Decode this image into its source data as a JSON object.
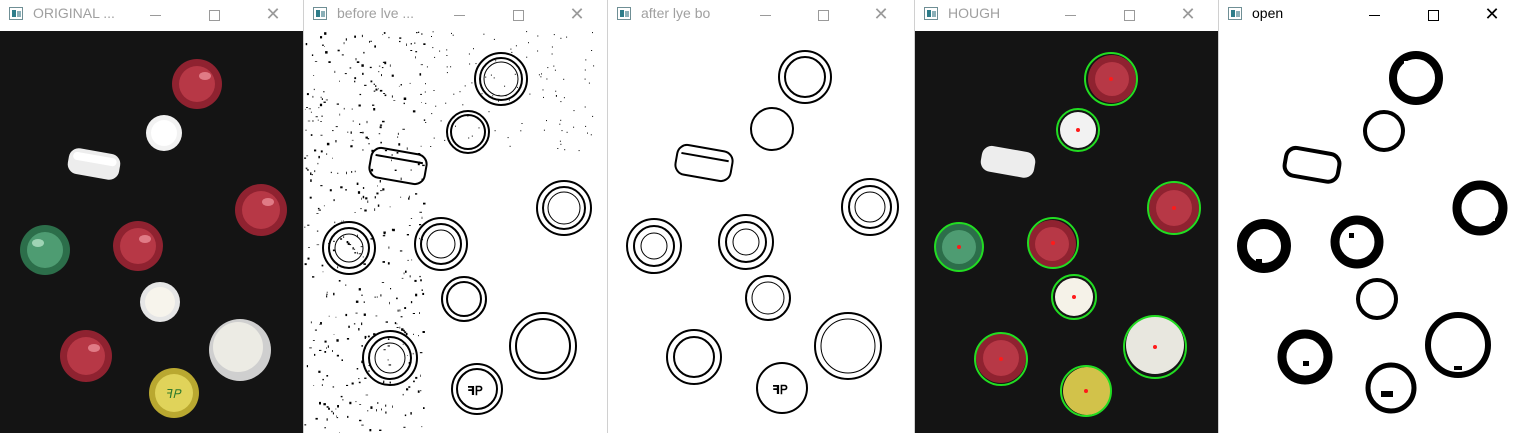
{
  "windows": [
    {
      "title": "ORIGINAL ...",
      "active": false
    },
    {
      "title": "before lve ...",
      "active": false
    },
    {
      "title": "after lye bo",
      "active": false
    },
    {
      "title": "HOUGH",
      "active": false
    },
    {
      "title": "open",
      "active": true
    }
  ],
  "colors": {
    "photo_bg": "#141414",
    "red_cap": "#a8303c",
    "green_cap": "#3e8b62",
    "white_cap": "#ececec",
    "yellow_cap": "#d9c94a",
    "hough_circle": "#22dd22",
    "hough_center": "#ff1a1a"
  },
  "icons": [
    "minimize-icon",
    "maximize-icon",
    "close-icon"
  ]
}
